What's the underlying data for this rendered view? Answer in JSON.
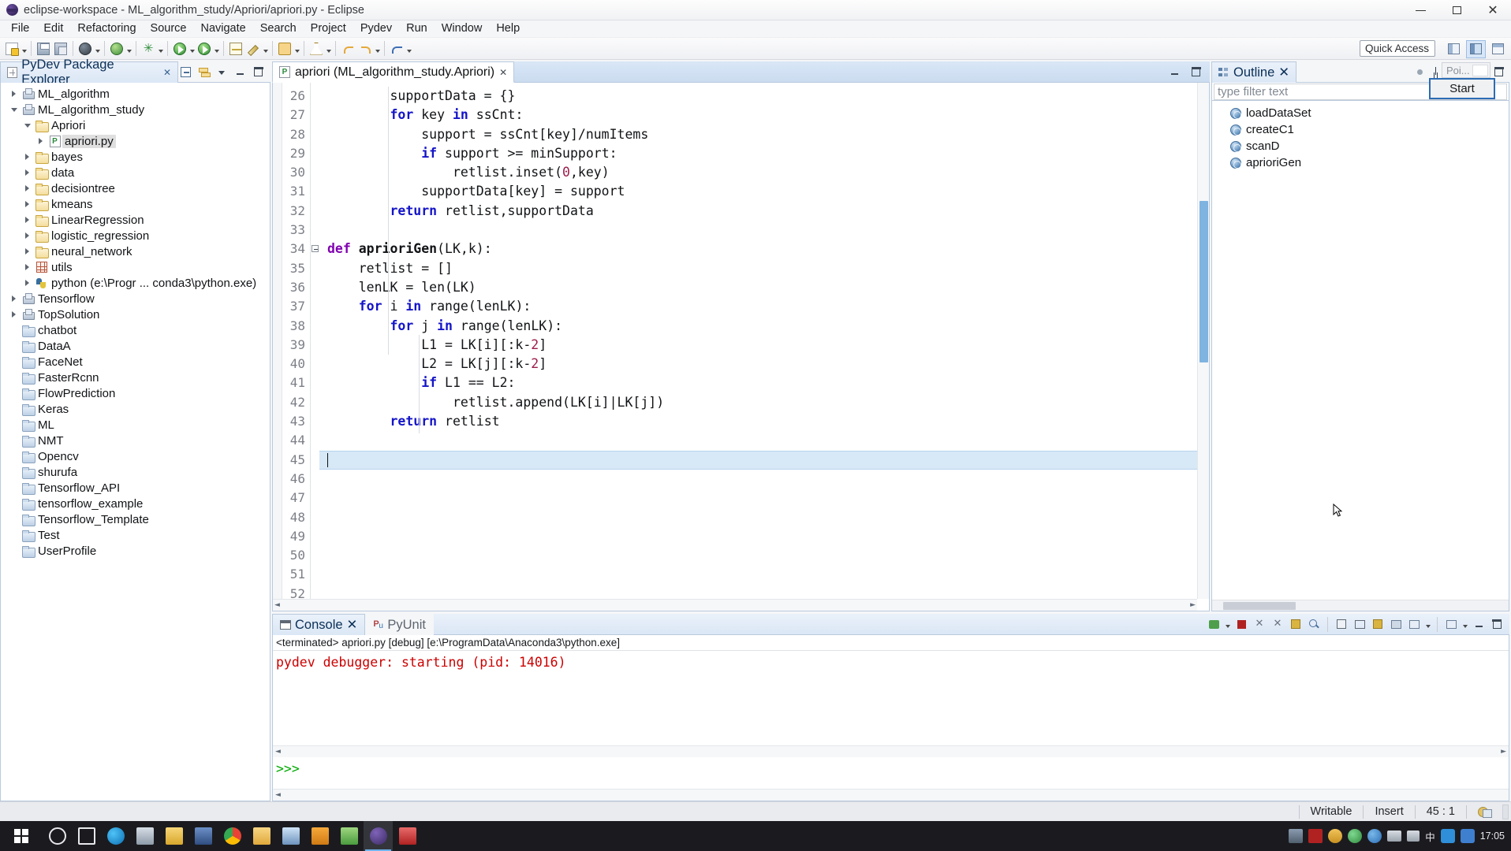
{
  "window": {
    "title": "eclipse-workspace - ML_algorithm_study/Apriori/apriori.py - Eclipse",
    "minimize_label": "Minimize",
    "maximize_label": "Maximize",
    "close_label": "Close"
  },
  "menu": {
    "items": [
      "File",
      "Edit",
      "Refactoring",
      "Source",
      "Navigate",
      "Search",
      "Project",
      "Pydev",
      "Run",
      "Window",
      "Help"
    ]
  },
  "toolbar": {
    "quick_access_placeholder": "Quick Access",
    "buttons": [
      "new-wizard",
      "save",
      "save-all",
      "debug-last",
      "external-tools",
      "pydev-package",
      "run-last",
      "coverage",
      "pydev-code-analysis",
      "pydev-globals",
      "run-pyunit",
      "back",
      "forward",
      "undo",
      "next-annotation"
    ],
    "perspectives": [
      "java-perspective",
      "pydev-perspective",
      "debug-perspective"
    ]
  },
  "explorer": {
    "title": "PyDev Package Explorer",
    "tools": [
      "collapse-all",
      "link-with-editor",
      "view-menu",
      "minimize",
      "maximize"
    ],
    "items": [
      {
        "label": "ML_algorithm",
        "icon": "project",
        "indent": 0,
        "twist": "closed",
        "selected": false
      },
      {
        "label": "ML_algorithm_study",
        "icon": "project",
        "indent": 0,
        "twist": "open",
        "selected": false
      },
      {
        "label": "Apriori",
        "icon": "folder",
        "indent": 1,
        "twist": "open",
        "selected": false
      },
      {
        "label": "apriori.py",
        "icon": "pyfile",
        "indent": 2,
        "twist": "closed",
        "selected": true
      },
      {
        "label": "bayes",
        "icon": "folder",
        "indent": 1,
        "twist": "closed",
        "selected": false
      },
      {
        "label": "data",
        "icon": "folder",
        "indent": 1,
        "twist": "closed",
        "selected": false
      },
      {
        "label": "decisiontree",
        "icon": "folder",
        "indent": 1,
        "twist": "closed",
        "selected": false
      },
      {
        "label": "kmeans",
        "icon": "folder",
        "indent": 1,
        "twist": "closed",
        "selected": false
      },
      {
        "label": "LinearRegression",
        "icon": "folder",
        "indent": 1,
        "twist": "closed",
        "selected": false
      },
      {
        "label": "logistic_regression",
        "icon": "folder",
        "indent": 1,
        "twist": "closed",
        "selected": false
      },
      {
        "label": "neural_network",
        "icon": "folder",
        "indent": 1,
        "twist": "closed",
        "selected": false
      },
      {
        "label": "utils",
        "icon": "package",
        "indent": 1,
        "twist": "closed",
        "selected": false
      },
      {
        "label": "python  (e:\\Progr ... conda3\\python.exe)",
        "icon": "python",
        "indent": 1,
        "twist": "closed",
        "selected": false
      },
      {
        "label": "Tensorflow",
        "icon": "project",
        "indent": 0,
        "twist": "closed",
        "selected": false
      },
      {
        "label": "TopSolution",
        "icon": "project",
        "indent": 0,
        "twist": "closed",
        "selected": false
      },
      {
        "label": "chatbot",
        "icon": "plainfolder",
        "indent": 0,
        "twist": "none",
        "selected": false
      },
      {
        "label": "DataA",
        "icon": "plainfolder",
        "indent": 0,
        "twist": "none",
        "selected": false
      },
      {
        "label": "FaceNet",
        "icon": "plainfolder",
        "indent": 0,
        "twist": "none",
        "selected": false
      },
      {
        "label": "FasterRcnn",
        "icon": "plainfolder",
        "indent": 0,
        "twist": "none",
        "selected": false
      },
      {
        "label": "FlowPrediction",
        "icon": "plainfolder",
        "indent": 0,
        "twist": "none",
        "selected": false
      },
      {
        "label": "Keras",
        "icon": "plainfolder",
        "indent": 0,
        "twist": "none",
        "selected": false
      },
      {
        "label": "ML",
        "icon": "plainfolder",
        "indent": 0,
        "twist": "none",
        "selected": false
      },
      {
        "label": "NMT",
        "icon": "plainfolder",
        "indent": 0,
        "twist": "none",
        "selected": false
      },
      {
        "label": "Opencv",
        "icon": "plainfolder",
        "indent": 0,
        "twist": "none",
        "selected": false
      },
      {
        "label": "shurufa",
        "icon": "plainfolder",
        "indent": 0,
        "twist": "none",
        "selected": false
      },
      {
        "label": "Tensorflow_API",
        "icon": "plainfolder",
        "indent": 0,
        "twist": "none",
        "selected": false
      },
      {
        "label": "tensorflow_example",
        "icon": "plainfolder",
        "indent": 0,
        "twist": "none",
        "selected": false
      },
      {
        "label": "Tensorflow_Template",
        "icon": "plainfolder",
        "indent": 0,
        "twist": "none",
        "selected": false
      },
      {
        "label": "Test",
        "icon": "plainfolder",
        "indent": 0,
        "twist": "none",
        "selected": false
      },
      {
        "label": "UserProfile",
        "icon": "plainfolder",
        "indent": 0,
        "twist": "none",
        "selected": false
      }
    ]
  },
  "editor": {
    "tab_label": "apriori (ML_algorithm_study.Apriori)",
    "first_line_number": 26,
    "last_line_number": 52,
    "current_line": 45,
    "lines": [
      {
        "n": 26,
        "tokens": [
          {
            "t": "        supportData = {}",
            "c": ""
          }
        ]
      },
      {
        "n": 27,
        "tokens": [
          {
            "t": "        ",
            "c": ""
          },
          {
            "t": "for",
            "c": "kw"
          },
          {
            "t": " key ",
            "c": ""
          },
          {
            "t": "in",
            "c": "kw"
          },
          {
            "t": " ssCnt:",
            "c": ""
          }
        ]
      },
      {
        "n": 28,
        "tokens": [
          {
            "t": "            support = ssCnt[key]/numItems",
            "c": ""
          }
        ]
      },
      {
        "n": 29,
        "tokens": [
          {
            "t": "            ",
            "c": ""
          },
          {
            "t": "if",
            "c": "kw"
          },
          {
            "t": " support >= minSupport:",
            "c": ""
          }
        ]
      },
      {
        "n": 30,
        "tokens": [
          {
            "t": "                retlist.inset(",
            "c": ""
          },
          {
            "t": "0",
            "c": "num"
          },
          {
            "t": ",key)",
            "c": ""
          }
        ]
      },
      {
        "n": 31,
        "tokens": [
          {
            "t": "            supportData[key] = support",
            "c": ""
          }
        ]
      },
      {
        "n": 32,
        "tokens": [
          {
            "t": "        ",
            "c": ""
          },
          {
            "t": "return",
            "c": "kw"
          },
          {
            "t": " retlist,supportData",
            "c": ""
          }
        ]
      },
      {
        "n": 33,
        "tokens": [
          {
            "t": "",
            "c": ""
          }
        ]
      },
      {
        "n": 34,
        "tokens": [
          {
            "t": "def",
            "c": "k"
          },
          {
            "t": " ",
            "c": ""
          },
          {
            "t": "aprioriGen",
            "c": "fn"
          },
          {
            "t": "(LK,k):",
            "c": ""
          }
        ],
        "fold": true
      },
      {
        "n": 35,
        "tokens": [
          {
            "t": "    retlist = []",
            "c": ""
          }
        ]
      },
      {
        "n": 36,
        "tokens": [
          {
            "t": "    lenLK = len(LK)",
            "c": ""
          }
        ]
      },
      {
        "n": 37,
        "tokens": [
          {
            "t": "    ",
            "c": ""
          },
          {
            "t": "for",
            "c": "kw"
          },
          {
            "t": " i ",
            "c": ""
          },
          {
            "t": "in",
            "c": "kw"
          },
          {
            "t": " range(lenLK):",
            "c": ""
          }
        ]
      },
      {
        "n": 38,
        "tokens": [
          {
            "t": "        ",
            "c": ""
          },
          {
            "t": "for",
            "c": "kw"
          },
          {
            "t": " j ",
            "c": ""
          },
          {
            "t": "in",
            "c": "kw"
          },
          {
            "t": " range(lenLK):",
            "c": ""
          }
        ]
      },
      {
        "n": 39,
        "tokens": [
          {
            "t": "            L1 = LK[i][:k-",
            "c": ""
          },
          {
            "t": "2",
            "c": "num"
          },
          {
            "t": "]",
            "c": ""
          }
        ]
      },
      {
        "n": 40,
        "tokens": [
          {
            "t": "            L2 = LK[j][:k-",
            "c": ""
          },
          {
            "t": "2",
            "c": "num"
          },
          {
            "t": "]",
            "c": ""
          }
        ]
      },
      {
        "n": 41,
        "tokens": [
          {
            "t": "            ",
            "c": ""
          },
          {
            "t": "if",
            "c": "kw"
          },
          {
            "t": " L1 == L2:",
            "c": ""
          }
        ]
      },
      {
        "n": 42,
        "tokens": [
          {
            "t": "                retlist.append(LK[i]|LK[j])",
            "c": ""
          }
        ]
      },
      {
        "n": 43,
        "tokens": [
          {
            "t": "        ",
            "c": ""
          },
          {
            "t": "return",
            "c": "kw"
          },
          {
            "t": " retlist",
            "c": ""
          }
        ]
      },
      {
        "n": 44,
        "tokens": [
          {
            "t": "",
            "c": ""
          }
        ]
      },
      {
        "n": 45,
        "tokens": [
          {
            "t": "",
            "c": ""
          }
        ]
      },
      {
        "n": 46,
        "tokens": [
          {
            "t": "",
            "c": ""
          }
        ]
      },
      {
        "n": 47,
        "tokens": [
          {
            "t": "",
            "c": ""
          }
        ]
      },
      {
        "n": 48,
        "tokens": [
          {
            "t": "",
            "c": ""
          }
        ]
      },
      {
        "n": 49,
        "tokens": [
          {
            "t": "",
            "c": ""
          }
        ]
      },
      {
        "n": 50,
        "tokens": [
          {
            "t": "",
            "c": ""
          }
        ]
      },
      {
        "n": 51,
        "tokens": [
          {
            "t": "",
            "c": ""
          }
        ]
      },
      {
        "n": 52,
        "tokens": [
          {
            "t": "",
            "c": ""
          }
        ]
      }
    ]
  },
  "outline": {
    "title": "Outline",
    "filter_placeholder": "type filter text",
    "poi_label": "Poi...",
    "start_tooltip": "Start",
    "items": [
      {
        "label": "loadDataSet",
        "icon": "method"
      },
      {
        "label": "createC1",
        "icon": "method"
      },
      {
        "label": "scanD",
        "icon": "method"
      },
      {
        "label": "aprioriGen",
        "icon": "method"
      }
    ]
  },
  "console": {
    "tabs": [
      {
        "label": "Console",
        "icon": "console-icon",
        "active": true
      },
      {
        "label": "PyUnit",
        "icon": "pyunit-icon",
        "active": false
      }
    ],
    "launch_line": "<terminated> apriori.py [debug] [e:\\ProgramData\\Anaconda3\\python.exe]",
    "output_line": "pydev debugger: starting (pid: 14016)",
    "prompt": ">>>",
    "output_color": "#cc0000",
    "prompt_color": "#00aa00"
  },
  "statusbar": {
    "writable": "Writable",
    "insert_mode": "Insert",
    "cursor_position": "45 : 1"
  },
  "taskbar": {
    "time": "17:05",
    "date": ""
  }
}
